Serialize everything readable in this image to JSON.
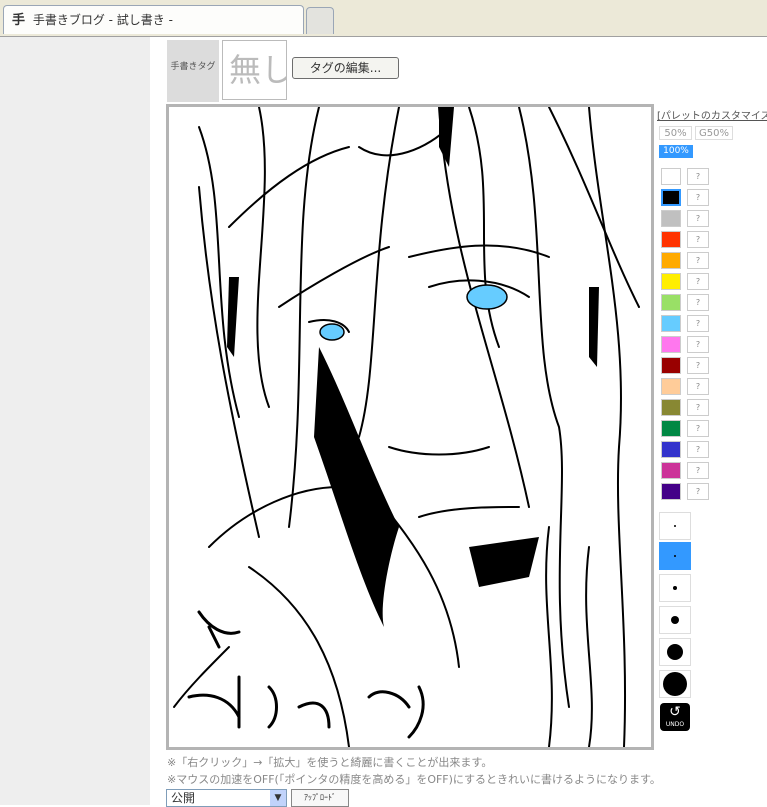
{
  "tab": {
    "icon": "手",
    "title": "手書きブログ - 試し書き -"
  },
  "tag": {
    "label": "手書きタグ",
    "thumb_text": "無し",
    "edit_button": "タグの編集..."
  },
  "palette": {
    "customize_link": "[パレットのカスタマイズ]",
    "zoom": [
      "50%",
      "G50%",
      "100%"
    ],
    "colors": [
      "#ffffff",
      "#000000",
      "#c0c0c0",
      "#ff3300",
      "#ffaa00",
      "#ffee00",
      "#99e066",
      "#66ccff",
      "#ff77ee",
      "#990000",
      "#ffcc99",
      "#888833",
      "#008844",
      "#3333cc",
      "#cc3399",
      "#440088"
    ],
    "q_label": "?",
    "undo_label": "UNDO"
  },
  "notes": {
    "line1": "※「右クリック」→「拡大」を使うと綺麗に書くことが出来ます。",
    "line2": "※マウスの加速をOFF(「ポインタの精度を高める」をOFF)にするときれいに書けるようになります。"
  },
  "visibility_select": "公開",
  "upload_button": "ｱｯﾌﾟﾛｰﾄﾞ",
  "accent_color": "#3399ff"
}
